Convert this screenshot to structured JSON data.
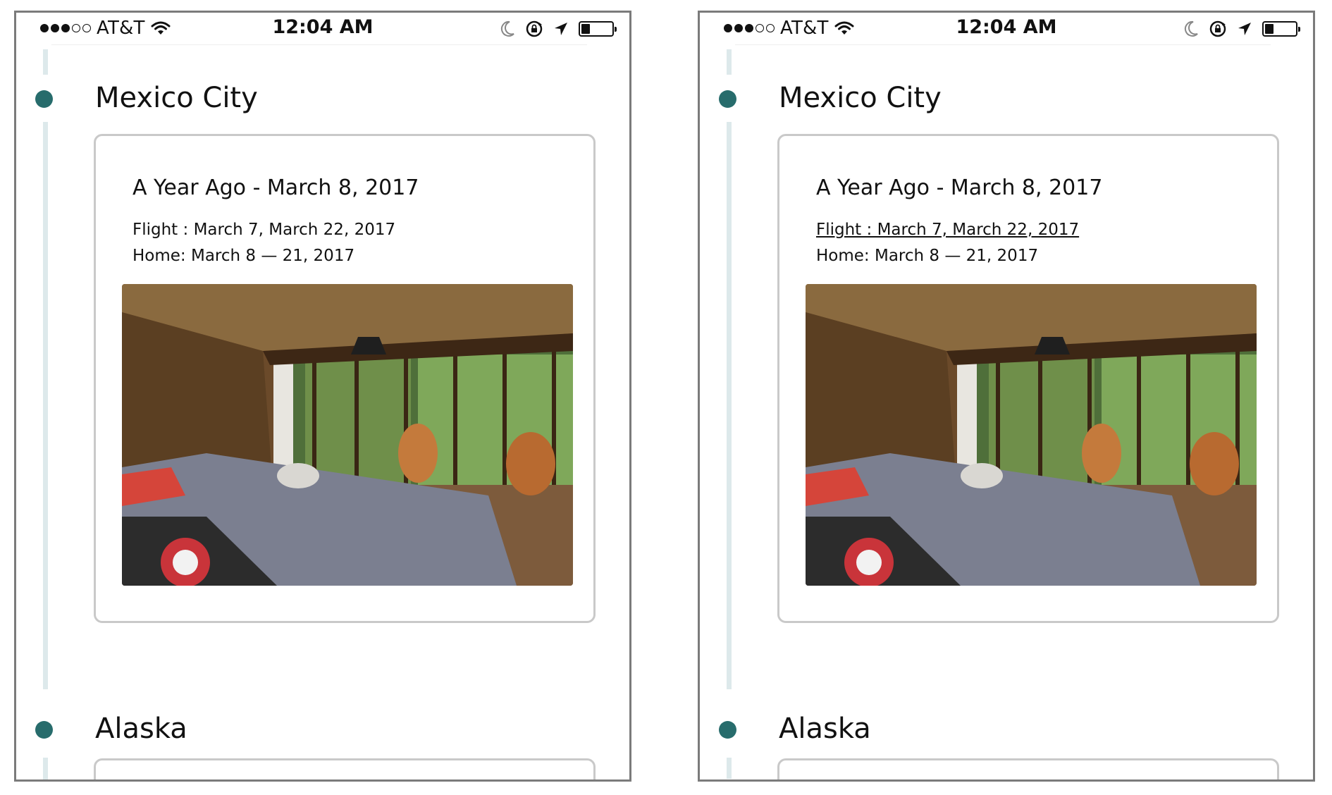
{
  "status_bar": {
    "carrier": "AT&T",
    "time": "12:04 AM",
    "battery_level": 0.25
  },
  "screens": [
    {
      "sections": [
        {
          "city": "Mexico City",
          "card": {
            "title": "A Year Ago - March 8, 2017",
            "flight": "Flight : March 7, March 22, 2017",
            "home": "Home: March 8 — 21, 2017"
          }
        },
        {
          "city": "Alaska"
        }
      ]
    },
    {
      "sections": [
        {
          "city": "Mexico City",
          "card": {
            "title": "A Year Ago - March 8, 2017",
            "flight": "Flight : March 7, March 22, 2017",
            "home": "Home: March 8 — 21, 2017"
          }
        },
        {
          "city": "Alaska"
        }
      ]
    }
  ],
  "icons": [
    "signal-dots-icon",
    "wifi-icon",
    "moon-icon",
    "orientation-lock-icon",
    "location-arrow-icon",
    "battery-icon"
  ],
  "colors": {
    "timeline_dot": "#276c6c",
    "timeline_line": "#dde9eb",
    "card_border": "#c9c9c9",
    "frame_border": "#7b7b7b"
  }
}
